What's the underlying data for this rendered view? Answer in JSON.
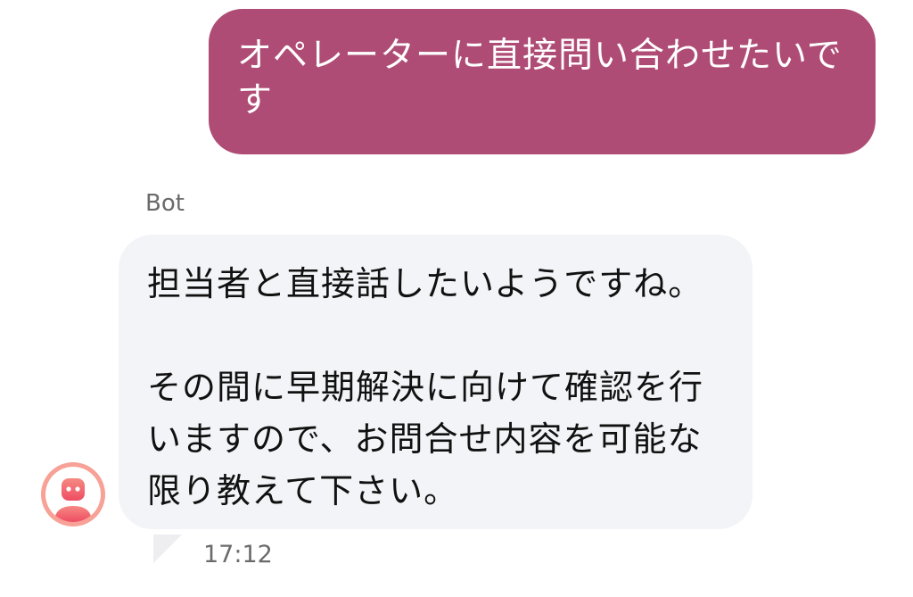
{
  "messages": {
    "user": {
      "text": "オペレーターに直接問い合わせたいです"
    },
    "bot": {
      "sender": "Bot",
      "text": "担当者と直接話したいようですね。\n\nその間に早期解決に向けて確認を行いますので、お問合せ内容を可能な限り教えて下さい。",
      "time": "17:12",
      "avatar_icon": "robot-avatar-icon"
    }
  },
  "colors": {
    "user_bubble": "#af4c75",
    "bot_bubble": "#f3f4f7",
    "avatar_gradient_top": "#f7a197",
    "avatar_gradient_bottom": "#ef4c63"
  }
}
